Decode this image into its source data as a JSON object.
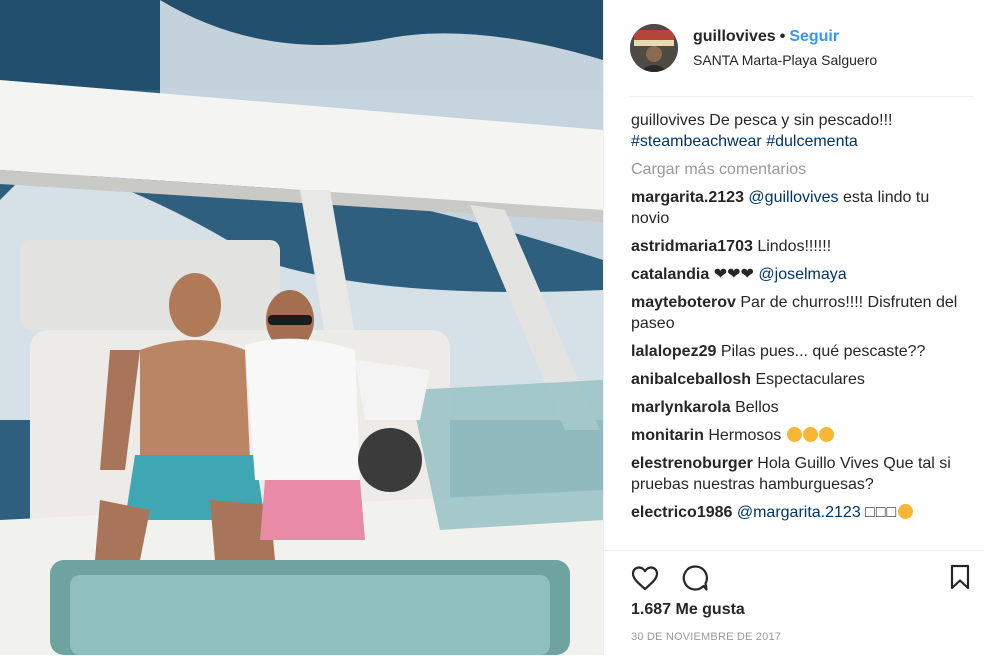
{
  "post": {
    "username": "guillovives",
    "separator": "•",
    "follow_label": "Seguir",
    "location": "SANTA Marta-Playa Salguero",
    "caption": {
      "user": "guillovives",
      "text": "De pesca y sin pescado!!!",
      "hashtag1": "#steambeachwear",
      "hashtag2": "#dulcementa"
    },
    "load_more": "Cargar más comentarios",
    "comments": [
      {
        "user": "margarita.2123",
        "mention": "@guillovives",
        "text": "esta lindo tu novio"
      },
      {
        "user": "astridmaria1703",
        "text": "Lindos!!!!!!"
      },
      {
        "user": "catalandia",
        "text": "❤❤❤",
        "mention": "@joselmaya"
      },
      {
        "user": "mayteboterov",
        "text": "Par de churros!!!! Disfruten del paseo"
      },
      {
        "user": "lalalopez29",
        "text": "Pilas pues... qué pescaste??"
      },
      {
        "user": "anibalceballosh",
        "text": "Espectaculares"
      },
      {
        "user": "marlynkarola",
        "text": "Bellos"
      },
      {
        "user": "monitarin",
        "text": "Hermosos"
      },
      {
        "user": "elestrenoburger",
        "text": "Hola Guillo Vives Que tal si pruebas nuestras hamburguesas?"
      },
      {
        "user": "electrico1986",
        "mention": "@margarita.2123",
        "text": "□□□"
      }
    ],
    "likes": "1.687 Me gusta",
    "date": "30 DE NOVIEMBRE DE 2017"
  },
  "icons": {
    "like": "heart-outline-icon",
    "comment": "speech-bubble-icon",
    "save": "bookmark-icon"
  },
  "colors": {
    "link_blue": "#3897f0",
    "hashtag_blue": "#003569",
    "muted_gray": "#999999",
    "text": "#262626"
  }
}
